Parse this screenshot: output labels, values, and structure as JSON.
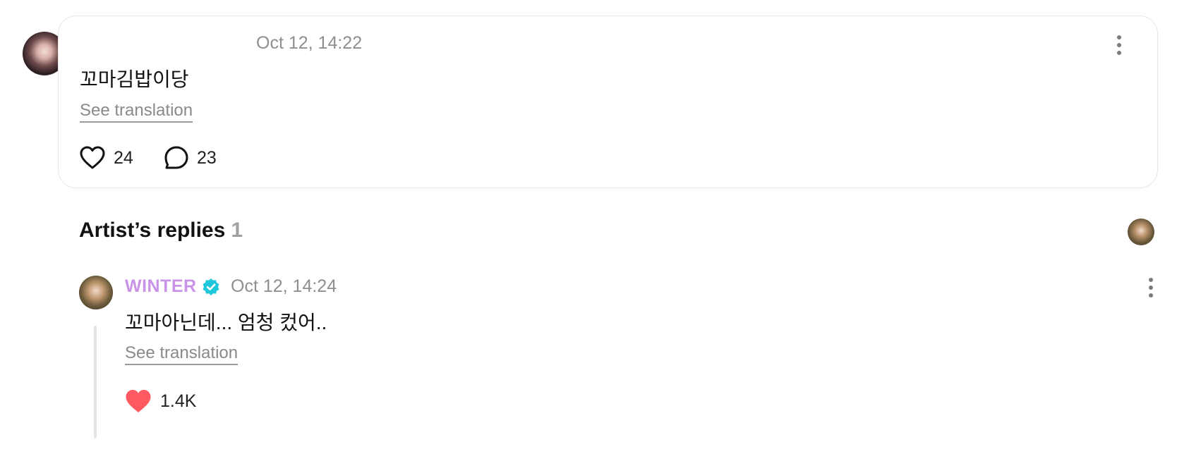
{
  "post": {
    "timestamp": "Oct 12, 14:22",
    "text": "꼬마김밥이당",
    "see_translation": "See translation",
    "like_count": "24",
    "comment_count": "23",
    "icons": {
      "like": "heart-outline-icon",
      "comment": "comment-bubble-icon",
      "menu": "more-vertical-icon"
    }
  },
  "artist_replies": {
    "title": "Artist’s replies",
    "count": "1"
  },
  "reply": {
    "author": "WINTER",
    "author_color": "#c993e8",
    "verified_color": "#1fc7dc",
    "timestamp": "Oct 12, 14:24",
    "text": "꼬마아닌데... 엄청 컸어..",
    "see_translation": "See translation",
    "like_count": "1.4K",
    "like_color": "#ff5a5f",
    "icons": {
      "like": "heart-filled-icon",
      "verified": "verified-badge-icon",
      "menu": "more-vertical-icon"
    }
  }
}
